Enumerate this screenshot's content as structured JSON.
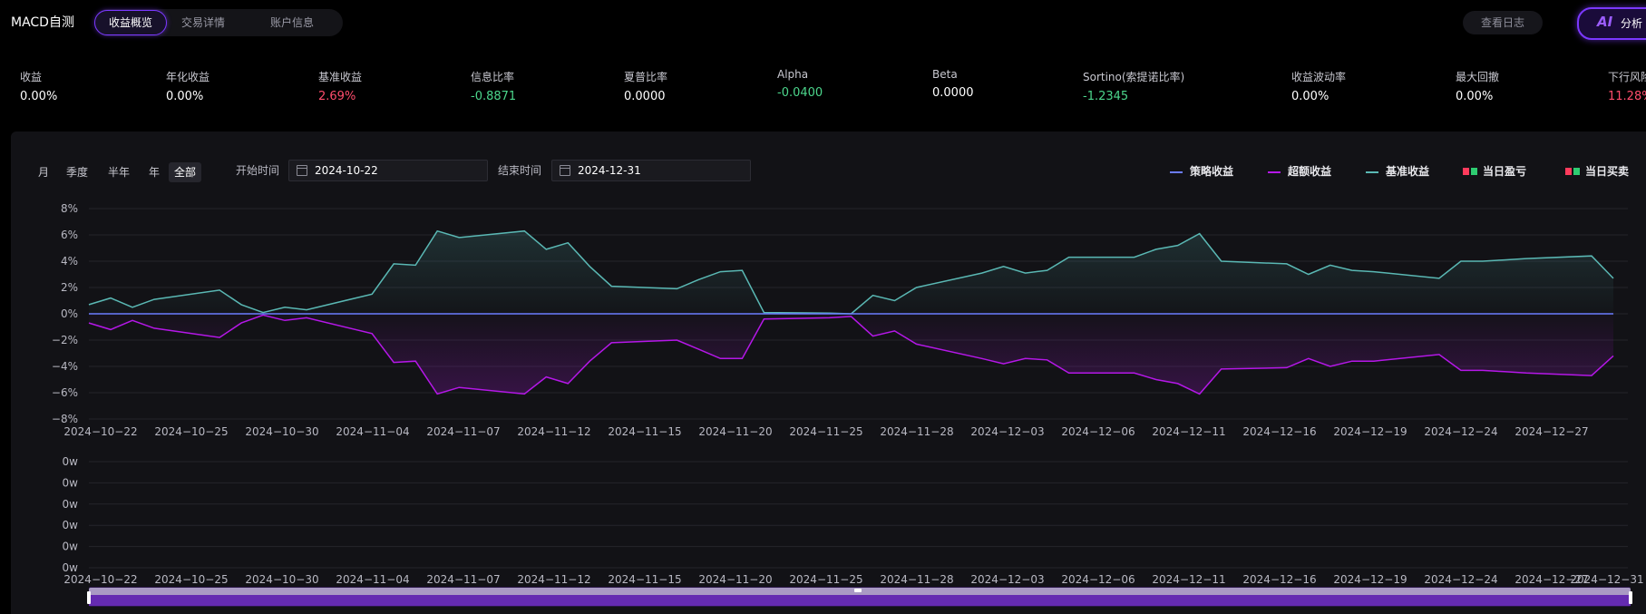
{
  "header": {
    "app_title": "MACD自测",
    "tabs": [
      {
        "label": "收益概览",
        "active": true
      },
      {
        "label": "交易详情",
        "active": false
      },
      {
        "label": "账户信息",
        "active": false
      }
    ],
    "log_button": "查看日志",
    "ai_button": {
      "icon": "AI",
      "label": "分析"
    }
  },
  "metrics": [
    {
      "label": "收益",
      "value": "0.00%",
      "tone": "neutral"
    },
    {
      "label": "年化收益",
      "value": "0.00%",
      "tone": "neutral"
    },
    {
      "label": "基准收益",
      "value": "2.69%",
      "tone": "red"
    },
    {
      "label": "信息比率",
      "value": "-0.8871",
      "tone": "green"
    },
    {
      "label": "夏普比率",
      "value": "0.0000",
      "tone": "neutral"
    },
    {
      "label": "Alpha",
      "value": "-0.0400",
      "tone": "green"
    },
    {
      "label": "Beta",
      "value": "0.0000",
      "tone": "neutral"
    },
    {
      "label": "Sortino(索提诺比率)",
      "value": "-1.2345",
      "tone": "green"
    },
    {
      "label": "收益波动率",
      "value": "0.00%",
      "tone": "neutral"
    },
    {
      "label": "最大回撤",
      "value": "0.00%",
      "tone": "neutral"
    },
    {
      "label": "下行风险",
      "value": "11.28%",
      "tone": "red"
    }
  ],
  "controls": {
    "periods": [
      {
        "label": "月",
        "active": false
      },
      {
        "label": "季度",
        "active": false
      },
      {
        "label": "半年",
        "active": false
      },
      {
        "label": "年",
        "active": false
      },
      {
        "label": "全部",
        "active": true
      }
    ],
    "start_label": "开始时间",
    "start_value": "2024-10-22",
    "end_label": "结束时间",
    "end_value": "2024-12-31"
  },
  "legend": [
    {
      "name": "策略收益",
      "color": "#6b7cff",
      "kind": "line"
    },
    {
      "name": "超额收益",
      "color": "#b517e8",
      "kind": "line"
    },
    {
      "name": "基准收益",
      "color": "#5ab8b4",
      "kind": "line"
    },
    {
      "name": "当日盈亏",
      "colors": [
        "#ff3b5c",
        "#2ecc71"
      ],
      "kind": "squares"
    },
    {
      "name": "当日买卖",
      "colors": [
        "#ff3b5c",
        "#2ecc71"
      ],
      "kind": "squares"
    }
  ],
  "colors": {
    "strategy": "#6b7cff",
    "excess": "#b517e8",
    "benchmark": "#5ab8b4",
    "accent": "#7b38ff"
  },
  "chart_data": [
    {
      "type": "line",
      "y_unit": "%",
      "ylim": [
        -8,
        8
      ],
      "y_ticks": [
        "8%",
        "6%",
        "4%",
        "2%",
        "0%",
        "−2%",
        "−4%",
        "−6%",
        "−8%"
      ],
      "x_tick_labels": [
        "2024−10−22",
        "2024−10−25",
        "2024−10−30",
        "2024−11−04",
        "2024−11−07",
        "2024−11−12",
        "2024−11−15",
        "2024−11−20",
        "2024−11−25",
        "2024−11−28",
        "2024−12−03",
        "2024−12−06",
        "2024−12−11",
        "2024−12−16",
        "2024−12−19",
        "2024−12−24",
        "2024−12−27"
      ],
      "x": [
        "2024-10-22",
        "2024-10-23",
        "2024-10-24",
        "2024-10-25",
        "2024-10-28",
        "2024-10-29",
        "2024-10-30",
        "2024-10-31",
        "2024-11-01",
        "2024-11-04",
        "2024-11-05",
        "2024-11-06",
        "2024-11-07",
        "2024-11-08",
        "2024-11-11",
        "2024-11-12",
        "2024-11-13",
        "2024-11-14",
        "2024-11-15",
        "2024-11-18",
        "2024-11-19",
        "2024-11-20",
        "2024-11-21",
        "2024-11-22",
        "2024-11-25",
        "2024-11-26",
        "2024-11-27",
        "2024-11-28",
        "2024-11-29",
        "2024-12-02",
        "2024-12-03",
        "2024-12-04",
        "2024-12-05",
        "2024-12-06",
        "2024-12-09",
        "2024-12-10",
        "2024-12-11",
        "2024-12-12",
        "2024-12-13",
        "2024-12-16",
        "2024-12-17",
        "2024-12-18",
        "2024-12-19",
        "2024-12-20",
        "2024-12-23",
        "2024-12-24",
        "2024-12-25",
        "2024-12-26",
        "2024-12-27",
        "2024-12-30",
        "2024-12-31"
      ],
      "series": [
        {
          "name": "策略收益",
          "values": [
            0,
            0,
            0,
            0,
            0,
            0,
            0,
            0,
            0,
            0,
            0,
            0,
            0,
            0,
            0,
            0,
            0,
            0,
            0,
            0,
            0,
            0,
            0,
            0,
            0,
            0,
            0,
            0,
            0,
            0,
            0,
            0,
            0,
            0,
            0,
            0,
            0,
            0,
            0,
            0,
            0,
            0,
            0,
            0,
            0,
            0,
            0,
            0,
            0,
            0,
            0
          ]
        },
        {
          "name": "超额收益",
          "values": [
            -0.7,
            -1.2,
            -0.5,
            -1.1,
            -1.8,
            -0.7,
            -0.1,
            -0.5,
            -0.3,
            -1.5,
            -3.7,
            -3.6,
            -6.1,
            -5.6,
            -6.1,
            -4.8,
            -5.3,
            -3.6,
            -2.2,
            -2.0,
            -2.7,
            -3.4,
            -3.4,
            -0.4,
            -0.3,
            -0.2,
            -1.7,
            -1.3,
            -2.3,
            -3.4,
            -3.8,
            -3.4,
            -3.5,
            -4.5,
            -4.5,
            -5.0,
            -5.3,
            -6.1,
            -4.2,
            -4.1,
            -3.4,
            -4.0,
            -3.6,
            -3.6,
            -3.1,
            -4.3,
            -4.3,
            -4.4,
            -4.5,
            -4.7,
            -3.2
          ]
        },
        {
          "name": "基准收益",
          "values": [
            0.7,
            1.2,
            0.5,
            1.1,
            1.8,
            0.7,
            0.1,
            0.5,
            0.3,
            1.5,
            3.8,
            3.7,
            6.3,
            5.8,
            6.3,
            4.9,
            5.4,
            3.6,
            2.1,
            1.9,
            2.6,
            3.2,
            3.3,
            0.1,
            0.05,
            0.0,
            1.4,
            1.0,
            2.0,
            3.1,
            3.6,
            3.1,
            3.3,
            4.3,
            4.3,
            4.9,
            5.2,
            6.1,
            4.0,
            3.8,
            3.0,
            3.7,
            3.3,
            3.2,
            2.7,
            4.0,
            4.0,
            4.1,
            4.2,
            4.4,
            2.7
          ]
        }
      ]
    },
    {
      "type": "bar",
      "y_ticks": [
        "0w",
        "0w",
        "0w",
        "0w",
        "0w",
        "0w"
      ],
      "x_tick_labels": [
        "2024−10−22",
        "2024−10−25",
        "2024−10−30",
        "2024−11−04",
        "2024−11−07",
        "2024−11−12",
        "2024−11−15",
        "2024−11−20",
        "2024−11−25",
        "2024−11−28",
        "2024−12−03",
        "2024−12−06",
        "2024−12−11",
        "2024−12−16",
        "2024−12−19",
        "2024−12−24",
        "2024−12−27",
        "2024−12−31"
      ],
      "series": []
    }
  ]
}
